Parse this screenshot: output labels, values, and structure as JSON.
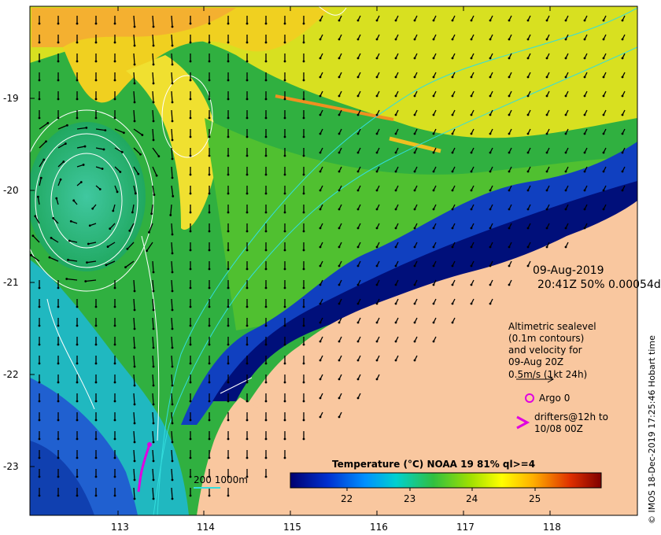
{
  "map": {
    "date": "09-Aug-2019",
    "time_info": "20:41Z  50% 0.00054d",
    "latitude_labels": [
      "-19",
      "-20",
      "-21",
      "-22",
      "-23"
    ],
    "longitude_labels": [
      "113",
      "114",
      "115",
      "116",
      "117",
      "118"
    ],
    "altimetry_label": [
      "Altimetric sealevel",
      "(0.1m contours)",
      "and velocity for",
      "09-Aug 20Z"
    ],
    "velocity_scale_label": "0.5m/s (1kt 24h)",
    "argo_label": "Argo 0",
    "drifters_label": [
      "drifters@12h to",
      "10/08 00Z"
    ],
    "bathymetry_label": "200  1000m",
    "colorbar_title": "Temperature (°C) NOAA 19 81% ql>=4",
    "colorbar_ticks": [
      "22",
      "23",
      "24",
      "25"
    ],
    "credit": "© IMOS 18-Dec-2019 17:25:46 Hobart time",
    "colors": {
      "land": "#f9c79f",
      "cold": "#000f7a",
      "accent_magenta": "#e000e0",
      "bathy_line": "#33dddd"
    }
  }
}
